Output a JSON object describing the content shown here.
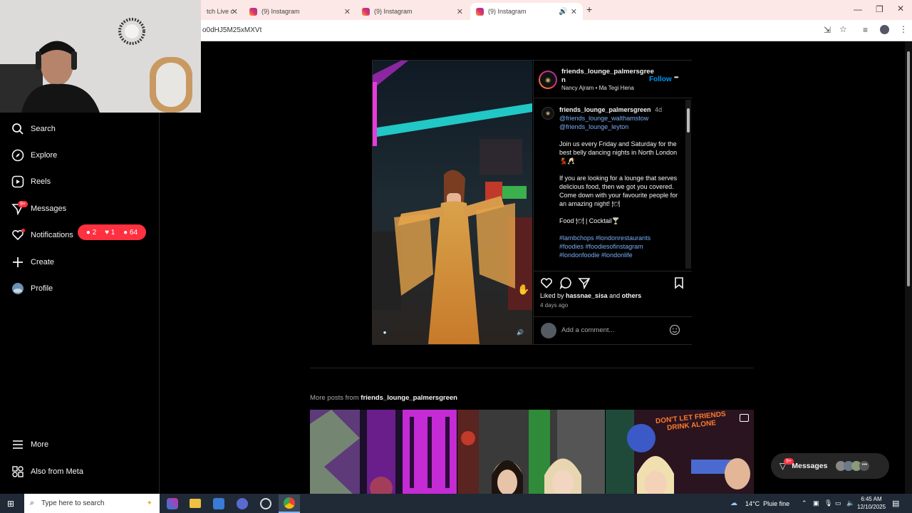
{
  "browser": {
    "tabs": [
      {
        "label": "tch Live c",
        "close": "✕"
      },
      {
        "label": "(9) Instagram",
        "close": "✕"
      },
      {
        "label": "(9) Instagram",
        "close": "✕"
      },
      {
        "label": "(9) Instagram",
        "close": "✕"
      }
    ],
    "new_tab": "+",
    "url": "o0dHJ5M25xMXVt"
  },
  "sidebar": {
    "items": [
      {
        "label": "Search"
      },
      {
        "label": "Explore"
      },
      {
        "label": "Reels"
      },
      {
        "label": "Messages",
        "badge": "9+"
      },
      {
        "label": "Notifications"
      },
      {
        "label": "Create"
      },
      {
        "label": "Profile"
      }
    ],
    "notif_pill": {
      "comments": "2",
      "likes": "1",
      "follows": "64"
    },
    "more": "More",
    "also_from_meta": "Also from Meta"
  },
  "post": {
    "username": "friends_lounge_palmersgree",
    "username_wrap": "n",
    "song": "Nancy Ajram • Ma Tegi Hena",
    "follow": "Follow",
    "more_menu": "•••",
    "caption": {
      "username": "friends_lounge_palmersgreen",
      "time": "4d",
      "mentions": [
        "@friends_lounge_walthamstow",
        "@friends_lounge_leyton"
      ],
      "paragraph1": "Join us every Friday and Saturday for the best belly dancing nights in North London💃🥂",
      "paragraph2": "If you are looking for a lounge that serves delicious food, then we got you covered. Come down with your favourite people for an amazing night! 🍽",
      "paragraph3": "Food 🍽 | Cocktail🍸",
      "hashtags_line1": "#lambchops #londonrestaurants",
      "hashtags_line2": "#foodies #foodiesofinstagram",
      "hashtags_line3": "#londonfoodie #londonlife"
    },
    "liked_by_prefix": "Liked by ",
    "liked_by_user": "hassnae_sisa",
    "liked_by_mid": " and ",
    "liked_by_others": "others",
    "date": "4 days ago",
    "comment_placeholder": "Add a comment..."
  },
  "more_posts": {
    "prefix": "More posts from ",
    "username": "friends_lounge_palmersgreen",
    "thumb_text": "DON'T LET FRIENDS DRINK ALONE"
  },
  "messages_button": {
    "label": "Messages",
    "badge": "9+"
  },
  "taskbar": {
    "search_placeholder": "Type here to search",
    "weather": "14°C  Pluie fine",
    "time": "6:45 AM",
    "date": "12/10/2025"
  },
  "colors": {
    "accent_blue": "#0095f6",
    "link_blue": "#79aef5",
    "notification_red": "#ff3040"
  }
}
